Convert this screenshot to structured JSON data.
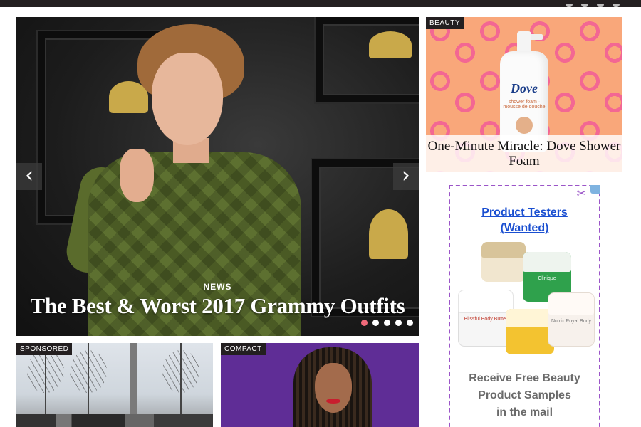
{
  "hero": {
    "category": "NEWS",
    "headline": "The Best & Worst 2017 Grammy Outfits",
    "prev_glyph": "‹",
    "next_glyph": "›",
    "slides": 5,
    "active_slide": 1
  },
  "beauty_card": {
    "tag": "BEAUTY",
    "title": "One-Minute Miracle: Dove Shower Foam",
    "product_brand": "Dove",
    "product_subtext": "shower foam · mousse de douche"
  },
  "ad": {
    "title_line1": "Product Testers",
    "title_line2": "(Wanted)",
    "body_line1": "Receive Free Beauty",
    "body_line2": "Product Samples",
    "body_line3": "in the mail",
    "scissors_icon": "scissors-icon",
    "jars": [
      "Blissful Body Butter",
      "Clinique",
      "Nutrix Royal Body"
    ]
  },
  "bottom_cards": [
    {
      "tag": "SPONSORED"
    },
    {
      "tag": "COMPACT"
    }
  ],
  "colors": {
    "topbar": "#231f20",
    "dot_active": "#f06a7a",
    "ad_border": "#9b55c8",
    "ad_link": "#1a4fd1",
    "compact_bg": "#5f2d96"
  }
}
